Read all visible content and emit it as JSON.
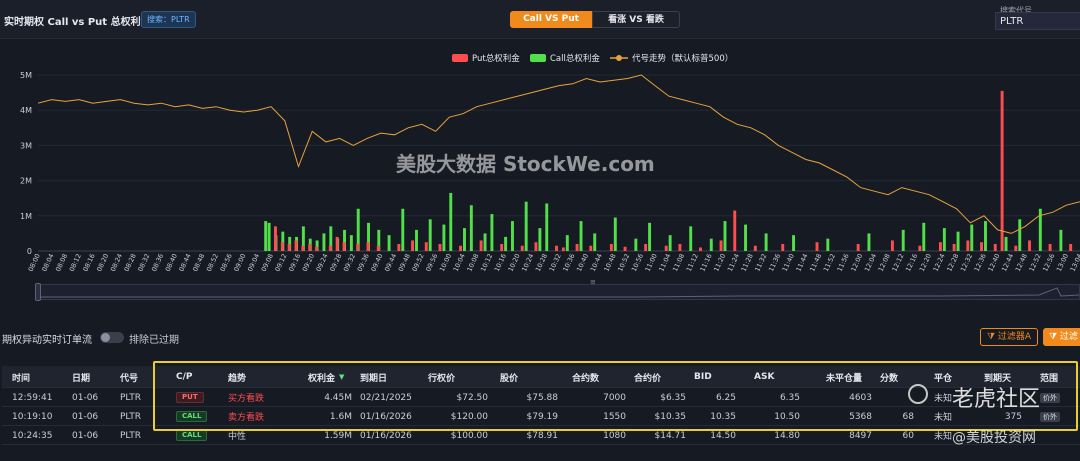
{
  "header": {
    "title": "实时期权 Call vs Put 总权利金",
    "search_tag": "搜索：PLTR",
    "tabs": [
      "Call VS Put",
      "看涨 VS 看跌"
    ],
    "search_label": "搜索代号",
    "search_value": "PLTR"
  },
  "watermark": "美股大数据 StockWe.com",
  "colors": {
    "put": "#ff4d4f",
    "call": "#52e04a",
    "line": "#e8a33c",
    "accent": "#f08a1c",
    "highlight": "#e9cf2e"
  },
  "chart_data": {
    "type": "bar",
    "legend": [
      "Put总权利金",
      "Call总权利金",
      "代号走势（默认标普500）"
    ],
    "legend_position": "top-center",
    "y_ticks": [
      "5M",
      "4M",
      "3M",
      "2M",
      "1M",
      "0"
    ],
    "ylim": [
      0,
      5000000
    ],
    "x_ticks": [
      "08:00",
      "08:04",
      "08:08",
      "08:12",
      "08:16",
      "08:20",
      "08:24",
      "08:28",
      "08:32",
      "08:36",
      "08:40",
      "08:44",
      "08:48",
      "08:52",
      "08:56",
      "09:00",
      "09:04",
      "09:08",
      "09:12",
      "09:16",
      "09:20",
      "09:24",
      "09:28",
      "09:32",
      "09:36",
      "09:40",
      "09:44",
      "09:48",
      "09:52",
      "09:56",
      "10:00",
      "10:04",
      "10:08",
      "10:12",
      "10:16",
      "10:20",
      "10:24",
      "10:28",
      "10:32",
      "10:36",
      "10:40",
      "10:44",
      "10:48",
      "10:52",
      "10:56",
      "11:00",
      "11:04",
      "11:08",
      "11:12",
      "11:16",
      "11:20",
      "11:24",
      "11:28",
      "11:32",
      "11:36",
      "11:40",
      "11:44",
      "11:48",
      "11:52",
      "11:56",
      "12:00",
      "12:04",
      "12:08",
      "12:12",
      "12:16",
      "12:20",
      "12:24",
      "12:28",
      "12:32",
      "12:36",
      "12:40",
      "12:44",
      "12:48",
      "12:52",
      "12:56",
      "13:00",
      "13:04"
    ],
    "series": [
      {
        "name": "Put总权利金",
        "x_index": [
          68,
          70,
          72,
          74,
          76,
          78,
          80,
          84,
          86,
          88,
          92,
          95,
          98,
          104,
          108,
          112,
          116,
          122,
          128,
          134,
          140,
          144,
          150,
          152,
          156,
          160,
          166,
          170,
          176,
          182,
          186,
          192,
          198,
          202,
          208,
          216,
          226,
          238,
          248,
          256,
          262,
          266,
          270,
          274,
          278,
          280,
          284,
          288,
          294,
          300
        ],
        "values": [
          700000,
          250000,
          200000,
          300000,
          150000,
          200000,
          120000,
          150000,
          400000,
          250000,
          200000,
          250000,
          150000,
          200000,
          300000,
          250000,
          200000,
          150000,
          300000,
          200000,
          150000,
          250000,
          150000,
          100000,
          200000,
          150000,
          200000,
          120000,
          200000,
          150000,
          200000,
          100000,
          300000,
          1150000,
          150000,
          200000,
          250000,
          200000,
          300000,
          150000,
          250000,
          200000,
          300000,
          250000,
          200000,
          4550000,
          150000,
          300000,
          200000,
          200000
        ]
      },
      {
        "name": "Call总权利金",
        "x_index": [
          66,
          67,
          69,
          71,
          73,
          75,
          77,
          79,
          81,
          83,
          85,
          87,
          89,
          91,
          93,
          96,
          99,
          102,
          106,
          110,
          114,
          118,
          120,
          124,
          126,
          130,
          132,
          136,
          138,
          142,
          146,
          148,
          154,
          158,
          162,
          168,
          174,
          178,
          184,
          190,
          196,
          200,
          206,
          212,
          220,
          230,
          242,
          252,
          258,
          264,
          268,
          272,
          276,
          282,
          286,
          292,
          298
        ],
        "values": [
          850000,
          800000,
          450000,
          550000,
          400000,
          400000,
          700000,
          350000,
          300000,
          500000,
          700000,
          350000,
          600000,
          450000,
          1200000,
          800000,
          600000,
          450000,
          1200000,
          600000,
          900000,
          750000,
          1650000,
          650000,
          1300000,
          500000,
          1050000,
          400000,
          850000,
          1400000,
          650000,
          1350000,
          450000,
          850000,
          500000,
          950000,
          350000,
          800000,
          450000,
          700000,
          350000,
          850000,
          750000,
          500000,
          450000,
          350000,
          500000,
          600000,
          800000,
          650000,
          550000,
          750000,
          850000,
          400000,
          900000,
          1200000,
          600000
        ]
      },
      {
        "name": "代号走势（默认标普500）",
        "values": [
          4.2,
          4.3,
          4.25,
          4.3,
          4.2,
          4.25,
          4.3,
          4.2,
          4.15,
          4.2,
          4.1,
          4.15,
          4.05,
          4.1,
          4.0,
          3.95,
          4.0,
          4.1,
          3.7,
          2.4,
          3.4,
          3.1,
          3.2,
          3.0,
          3.2,
          3.35,
          3.3,
          3.5,
          3.6,
          3.4,
          3.8,
          3.9,
          4.1,
          4.2,
          4.3,
          4.4,
          4.5,
          4.6,
          4.7,
          4.75,
          4.9,
          4.8,
          4.85,
          4.9,
          5.0,
          4.7,
          4.4,
          4.3,
          4.2,
          4.1,
          3.8,
          3.6,
          3.5,
          3.3,
          3.0,
          2.8,
          2.6,
          2.5,
          2.3,
          2.1,
          1.8,
          1.7,
          1.6,
          1.8,
          1.7,
          1.6,
          1.4,
          1.2,
          0.8,
          1.0,
          0.6,
          0.5,
          0.7,
          1.0,
          1.1,
          1.3,
          1.4
        ]
      }
    ]
  },
  "subheader": {
    "title": "期权异动实时订单流",
    "toggle_label": "排除已过期",
    "filter_a": "过滤器A",
    "filter_b": "过滤"
  },
  "table": {
    "columns": [
      "时间",
      "日期",
      "代号",
      "C/P",
      "趋势",
      "权利金",
      "到期日",
      "行权价",
      "股价",
      "合约数",
      "合约价",
      "BID",
      "ASK",
      "未平仓量",
      "分数",
      "平仓",
      "到期天",
      "范围"
    ],
    "rows": [
      [
        "12:59:41",
        "01-06",
        "PLTR",
        "PUT",
        "买方看跌",
        "4.45M",
        "02/21/2025",
        "$72.50",
        "$75.88",
        "7000",
        "$6.35",
        "6.25",
        "6.35",
        "4603",
        "",
        "未知",
        "",
        "价外"
      ],
      [
        "10:19:10",
        "01-06",
        "PLTR",
        "CALL",
        "卖方看跌",
        "1.6M",
        "01/16/2026",
        "$120.00",
        "$79.19",
        "1550",
        "$10.35",
        "10.35",
        "10.50",
        "5368",
        "68",
        "未知",
        "375",
        "价外"
      ],
      [
        "10:24:35",
        "01-06",
        "PLTR",
        "CALL",
        "中性",
        "1.59M",
        "01/16/2026",
        "$100.00",
        "$78.91",
        "1080",
        "$14.71",
        "14.50",
        "14.80",
        "8497",
        "60",
        "未知",
        "",
        ""
      ]
    ]
  },
  "watermarks": {
    "tiger": "老虎社区",
    "brand": "@美股投资网"
  }
}
